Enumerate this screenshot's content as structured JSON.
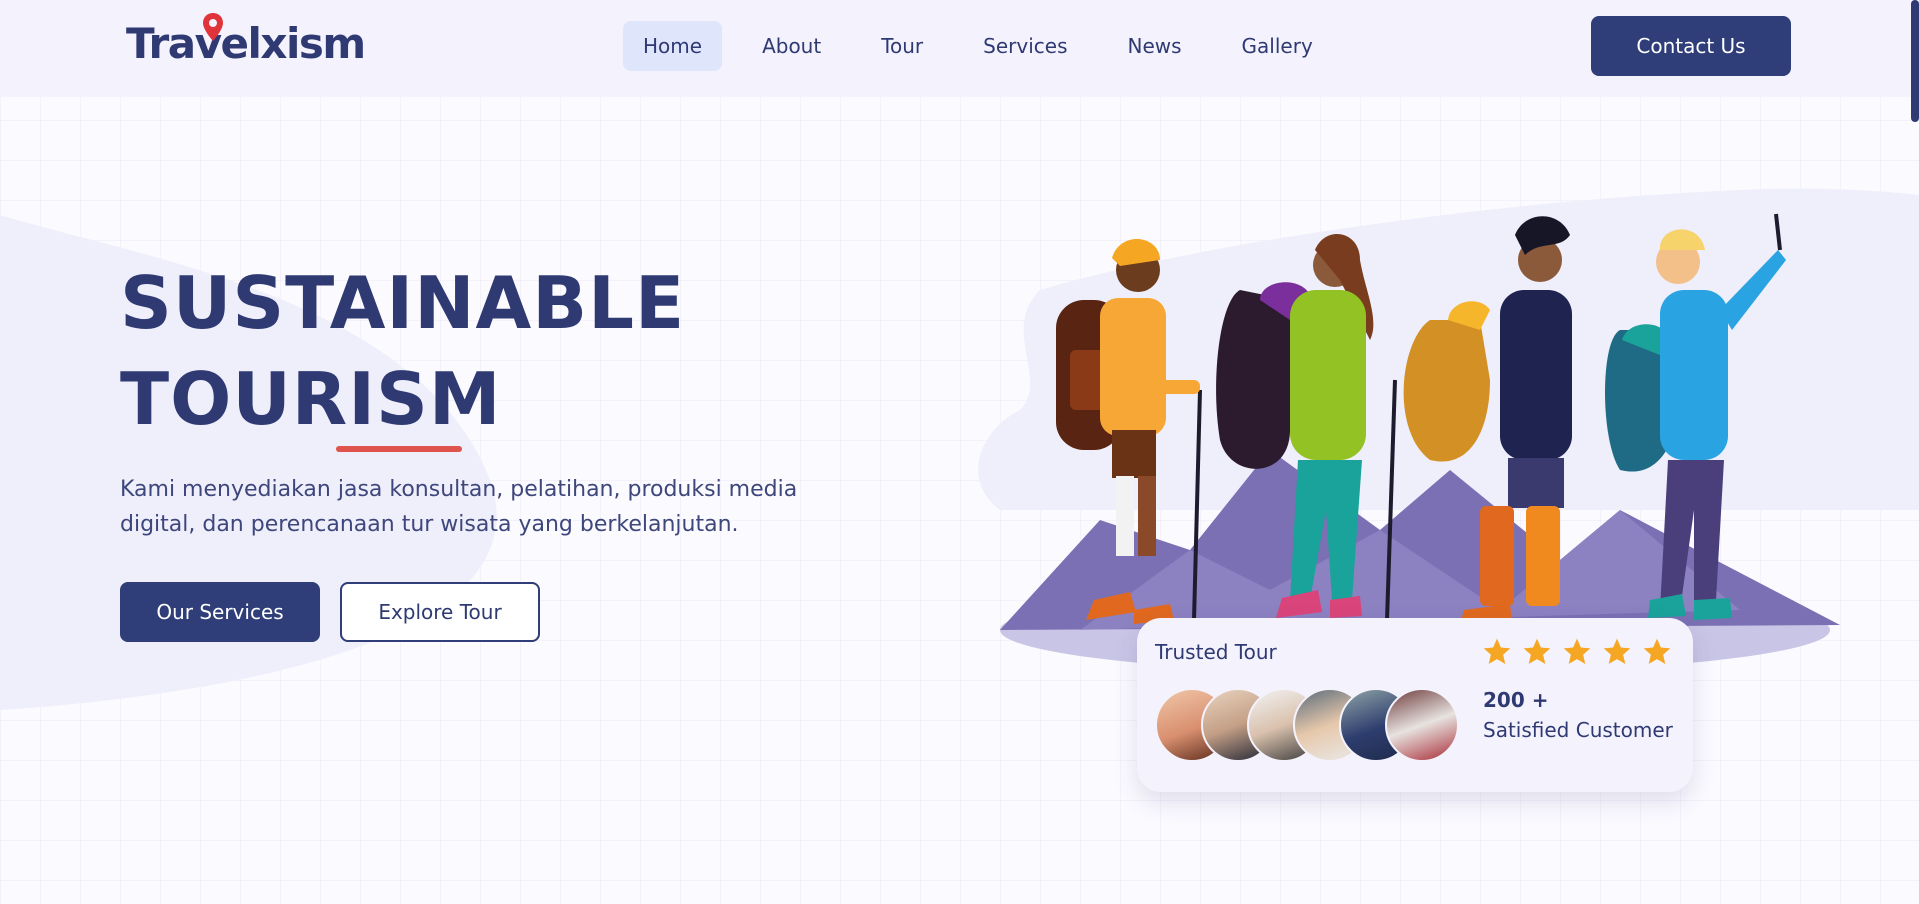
{
  "brand": {
    "logo_text": "Travelxism"
  },
  "nav": {
    "items": [
      {
        "label": "Home",
        "active": true
      },
      {
        "label": "About"
      },
      {
        "label": "Tour"
      },
      {
        "label": "Services"
      },
      {
        "label": "News"
      },
      {
        "label": "Gallery"
      }
    ],
    "contact_label": "Contact Us"
  },
  "hero": {
    "title_line1": "SUSTAINABLE",
    "title_line2": "TOURISM",
    "description": "Kami menyediakan jasa konsultan, pelatihan, produksi media digital, dan perencanaan tur wisata yang berkelanjutan.",
    "primary_button": "Our Services",
    "secondary_button": "Explore Tour"
  },
  "trust": {
    "label": "Trusted Tour",
    "rating_stars": 5,
    "count": "200 +",
    "count_label": "Satisfied Customer"
  },
  "colors": {
    "primary": "#2f3d78",
    "accent": "#e0534c",
    "star": "#f5a623",
    "header_bg": "#f3f2fd"
  },
  "icons": [
    "location-pin-icon",
    "star-icon"
  ]
}
